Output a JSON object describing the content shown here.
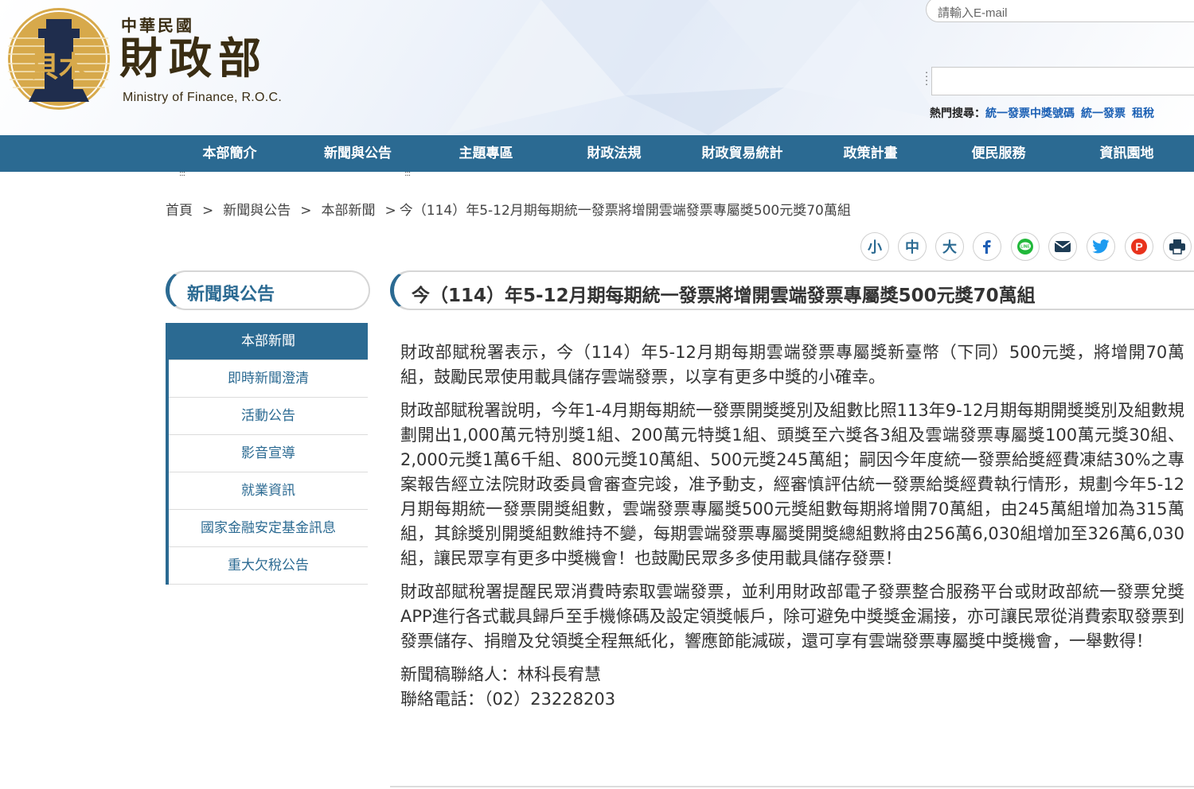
{
  "header": {
    "logo_small": "中華民國",
    "logo_main": "財政部",
    "logo_en": "Ministry of Finance, R.O.C.",
    "email_placeholder": "請輸入E-mail",
    "hot_search_label": "熱門搜尋：",
    "hot_search_links": [
      "統一發票中獎號碼",
      "統一發票",
      "租稅"
    ]
  },
  "nav": {
    "items": [
      "本部簡介",
      "新聞與公告",
      "主題專區",
      "財政法規",
      "財政貿易統計",
      "政策計畫",
      "便民服務",
      "資訊園地"
    ]
  },
  "breadcrumb": {
    "items": [
      "首頁",
      "新聞與公告",
      "本部新聞",
      "今（114）年5-12月期每期統一發票將增開雲端發票專屬獎500元獎70萬組"
    ],
    "separator": ">"
  },
  "tools": {
    "font_small": "小",
    "font_medium": "中",
    "font_large": "大",
    "facebook": "f",
    "line": "LINE",
    "email": "✉",
    "twitter": "twitter",
    "plurk": "P",
    "print": "print"
  },
  "sidebar": {
    "title": "新聞與公告",
    "items": [
      "本部新聞",
      "即時新聞澄清",
      "活動公告",
      "影音宣導",
      "就業資訊",
      "國家金融安定基金訊息",
      "重大欠稅公告"
    ]
  },
  "article": {
    "title": "今（114）年5-12月期每期統一發票將增開雲端發票專屬獎500元獎70萬組",
    "paragraphs": [
      "財政部賦稅署表示，今（114）年5-12月期每期雲端發票專屬獎新臺幣（下同）500元獎，將增開70萬組，鼓勵民眾使用載具儲存雲端發票，以享有更多中獎的小確幸。",
      "財政部賦稅署說明，今年1-4月期每期統一發票開獎獎別及組數比照113年9-12月期每期開獎獎別及組數規劃開出1,000萬元特別獎1組、200萬元特獎1組、頭獎至六獎各3組及雲端發票專屬獎100萬元獎30組、2,000元獎1萬6千組、800元獎10萬組、500元獎245萬組；嗣因今年度統一發票給獎經費凍結30%之專案報告經立法院財政委員會審查完竣，准予動支，經審慎評估統一發票給獎經費執行情形，規劃今年5-12月期每期統一發票開獎組數，雲端發票專屬獎500元獎組數每期將增開70萬組，由245萬組增加為315萬組，其餘獎別開獎組數維持不變，每期雲端發票專屬獎開獎總組數將由256萬6,030組增加至326萬6,030組，讓民眾享有更多中獎機會！也鼓勵民眾多多使用載具儲存發票！",
      "財政部賦稅署提醒民眾消費時索取雲端發票，並利用財政部電子發票整合服務平台或財政部統一發票兌獎APP進行各式載具歸戶至手機條碼及設定領獎帳戶，除可避免中獎獎金漏接，亦可讓民眾從消費索取發票到發票儲存、捐贈及兌領獎全程無紙化，響應節能減碳，還可享有雲端發票專屬獎中獎機會，一舉數得！"
    ],
    "contact_person": "新聞稿聯絡人：林科長宥慧",
    "contact_phone": "聯絡電話：（02）23228203"
  },
  "colors": {
    "nav_bg": "#2b6a92",
    "accent": "#2b6a92",
    "link": "#1a5fb4",
    "logo_gold": "#d7a94b",
    "logo_dark": "#3a2d13"
  }
}
